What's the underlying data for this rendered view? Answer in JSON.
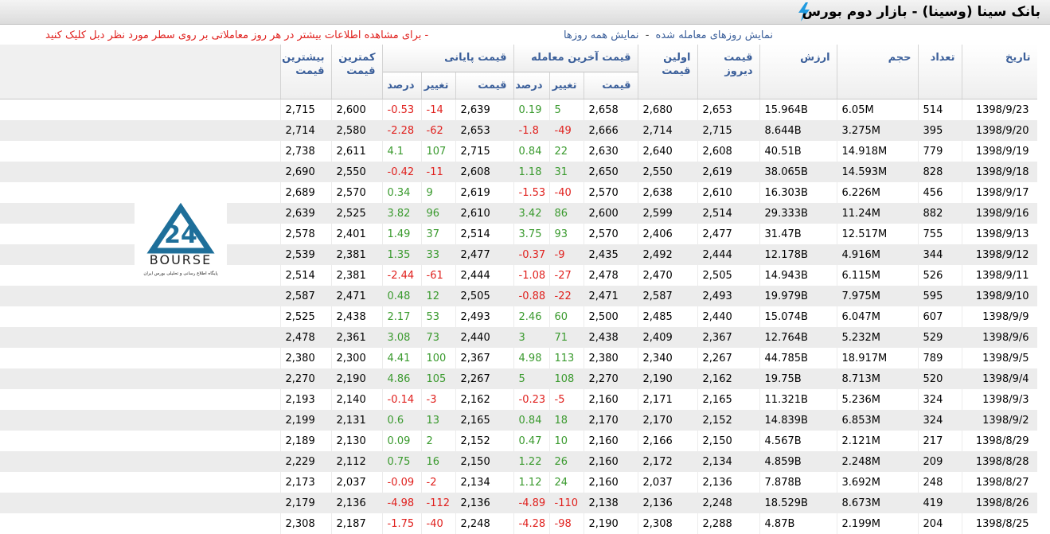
{
  "title": "بانک سینا (وسینا) - بازار دوم بورس",
  "help": {
    "link1": "نمایش روزهای معامله شده",
    "sep": "-",
    "link2": "نمایش همه روزها",
    "instruction": "- برای مشاهده اطلاعات بیشتر در هر روز معاملاتی بر روی سطر مورد نظر دبل کلیک کنید"
  },
  "logo": {
    "name": "BOURSE",
    "mark": "24",
    "tagline": "پایگاه اطلاع رسانی و تحلیلی بورس ایران"
  },
  "headers": {
    "date": "تاریخ",
    "count": "تعداد",
    "volume": "حجم",
    "value": "ارزش",
    "prev_line1": "قیمت",
    "prev_line2": "دیروز",
    "first_line1": "اولین",
    "first_line2": "قیمت",
    "last_group": "قیمت آخرین معامله",
    "close_group": "قیمت پایانی",
    "price": "قیمت",
    "change": "تغییر",
    "percent": "درصد",
    "min_line1": "کمترین",
    "min_line2": "قیمت",
    "max_line1": "بیشترین",
    "max_line2": "قیمت"
  },
  "rows": [
    {
      "date": "1398/9/23",
      "count": "514",
      "volume": "6.05M",
      "value": "15.964B",
      "prev": "2,653",
      "first": "2,680",
      "last_price": "2,658",
      "last_change": "5",
      "last_pct": "0.19",
      "close_price": "2,639",
      "close_change": "-14",
      "close_pct": "-0.53",
      "min": "2,600",
      "max": "2,715"
    },
    {
      "date": "1398/9/20",
      "count": "395",
      "volume": "3.275M",
      "value": "8.644B",
      "prev": "2,715",
      "first": "2,714",
      "last_price": "2,666",
      "last_change": "-49",
      "last_pct": "-1.8",
      "close_price": "2,653",
      "close_change": "-62",
      "close_pct": "-2.28",
      "min": "2,580",
      "max": "2,714"
    },
    {
      "date": "1398/9/19",
      "count": "779",
      "volume": "14.918M",
      "value": "40.51B",
      "prev": "2,608",
      "first": "2,640",
      "last_price": "2,630",
      "last_change": "22",
      "last_pct": "0.84",
      "close_price": "2,715",
      "close_change": "107",
      "close_pct": "4.1",
      "min": "2,611",
      "max": "2,738"
    },
    {
      "date": "1398/9/18",
      "count": "828",
      "volume": "14.593M",
      "value": "38.065B",
      "prev": "2,619",
      "first": "2,550",
      "last_price": "2,650",
      "last_change": "31",
      "last_pct": "1.18",
      "close_price": "2,608",
      "close_change": "-11",
      "close_pct": "-0.42",
      "min": "2,550",
      "max": "2,690"
    },
    {
      "date": "1398/9/17",
      "count": "456",
      "volume": "6.226M",
      "value": "16.303B",
      "prev": "2,610",
      "first": "2,638",
      "last_price": "2,570",
      "last_change": "-40",
      "last_pct": "-1.53",
      "close_price": "2,619",
      "close_change": "9",
      "close_pct": "0.34",
      "min": "2,570",
      "max": "2,689"
    },
    {
      "date": "1398/9/16",
      "count": "882",
      "volume": "11.24M",
      "value": "29.333B",
      "prev": "2,514",
      "first": "2,599",
      "last_price": "2,600",
      "last_change": "86",
      "last_pct": "3.42",
      "close_price": "2,610",
      "close_change": "96",
      "close_pct": "3.82",
      "min": "2,525",
      "max": "2,639"
    },
    {
      "date": "1398/9/13",
      "count": "755",
      "volume": "12.517M",
      "value": "31.47B",
      "prev": "2,477",
      "first": "2,406",
      "last_price": "2,570",
      "last_change": "93",
      "last_pct": "3.75",
      "close_price": "2,514",
      "close_change": "37",
      "close_pct": "1.49",
      "min": "2,401",
      "max": "2,578"
    },
    {
      "date": "1398/9/12",
      "count": "344",
      "volume": "4.916M",
      "value": "12.178B",
      "prev": "2,444",
      "first": "2,492",
      "last_price": "2,435",
      "last_change": "-9",
      "last_pct": "-0.37",
      "close_price": "2,477",
      "close_change": "33",
      "close_pct": "1.35",
      "min": "2,381",
      "max": "2,539"
    },
    {
      "date": "1398/9/11",
      "count": "526",
      "volume": "6.115M",
      "value": "14.943B",
      "prev": "2,505",
      "first": "2,470",
      "last_price": "2,478",
      "last_change": "-27",
      "last_pct": "-1.08",
      "close_price": "2,444",
      "close_change": "-61",
      "close_pct": "-2.44",
      "min": "2,381",
      "max": "2,514"
    },
    {
      "date": "1398/9/10",
      "count": "595",
      "volume": "7.975M",
      "value": "19.979B",
      "prev": "2,493",
      "first": "2,587",
      "last_price": "2,471",
      "last_change": "-22",
      "last_pct": "-0.88",
      "close_price": "2,505",
      "close_change": "12",
      "close_pct": "0.48",
      "min": "2,471",
      "max": "2,587"
    },
    {
      "date": "1398/9/9",
      "count": "607",
      "volume": "6.047M",
      "value": "15.074B",
      "prev": "2,440",
      "first": "2,485",
      "last_price": "2,500",
      "last_change": "60",
      "last_pct": "2.46",
      "close_price": "2,493",
      "close_change": "53",
      "close_pct": "2.17",
      "min": "2,438",
      "max": "2,525"
    },
    {
      "date": "1398/9/6",
      "count": "529",
      "volume": "5.232M",
      "value": "12.764B",
      "prev": "2,367",
      "first": "2,409",
      "last_price": "2,438",
      "last_change": "71",
      "last_pct": "3",
      "close_price": "2,440",
      "close_change": "73",
      "close_pct": "3.08",
      "min": "2,361",
      "max": "2,478"
    },
    {
      "date": "1398/9/5",
      "count": "789",
      "volume": "18.917M",
      "value": "44.785B",
      "prev": "2,267",
      "first": "2,340",
      "last_price": "2,380",
      "last_change": "113",
      "last_pct": "4.98",
      "close_price": "2,367",
      "close_change": "100",
      "close_pct": "4.41",
      "min": "2,300",
      "max": "2,380"
    },
    {
      "date": "1398/9/4",
      "count": "520",
      "volume": "8.713M",
      "value": "19.75B",
      "prev": "2,162",
      "first": "2,190",
      "last_price": "2,270",
      "last_change": "108",
      "last_pct": "5",
      "close_price": "2,267",
      "close_change": "105",
      "close_pct": "4.86",
      "min": "2,190",
      "max": "2,270"
    },
    {
      "date": "1398/9/3",
      "count": "324",
      "volume": "5.236M",
      "value": "11.321B",
      "prev": "2,165",
      "first": "2,171",
      "last_price": "2,160",
      "last_change": "-5",
      "last_pct": "-0.23",
      "close_price": "2,162",
      "close_change": "-3",
      "close_pct": "-0.14",
      "min": "2,140",
      "max": "2,193"
    },
    {
      "date": "1398/9/2",
      "count": "324",
      "volume": "6.853M",
      "value": "14.839B",
      "prev": "2,152",
      "first": "2,170",
      "last_price": "2,170",
      "last_change": "18",
      "last_pct": "0.84",
      "close_price": "2,165",
      "close_change": "13",
      "close_pct": "0.6",
      "min": "2,131",
      "max": "2,199"
    },
    {
      "date": "1398/8/29",
      "count": "217",
      "volume": "2.121M",
      "value": "4.567B",
      "prev": "2,150",
      "first": "2,166",
      "last_price": "2,160",
      "last_change": "10",
      "last_pct": "0.47",
      "close_price": "2,152",
      "close_change": "2",
      "close_pct": "0.09",
      "min": "2,130",
      "max": "2,189"
    },
    {
      "date": "1398/8/28",
      "count": "209",
      "volume": "2.248M",
      "value": "4.859B",
      "prev": "2,134",
      "first": "2,172",
      "last_price": "2,160",
      "last_change": "26",
      "last_pct": "1.22",
      "close_price": "2,150",
      "close_change": "16",
      "close_pct": "0.75",
      "min": "2,112",
      "max": "2,229"
    },
    {
      "date": "1398/8/27",
      "count": "248",
      "volume": "3.692M",
      "value": "7.878B",
      "prev": "2,136",
      "first": "2,037",
      "last_price": "2,160",
      "last_change": "24",
      "last_pct": "1.12",
      "close_price": "2,134",
      "close_change": "-2",
      "close_pct": "-0.09",
      "min": "2,037",
      "max": "2,173"
    },
    {
      "date": "1398/8/26",
      "count": "419",
      "volume": "8.673M",
      "value": "18.529B",
      "prev": "2,248",
      "first": "2,136",
      "last_price": "2,138",
      "last_change": "-110",
      "last_pct": "-4.89",
      "close_price": "2,136",
      "close_change": "-112",
      "close_pct": "-4.98",
      "min": "2,136",
      "max": "2,179"
    },
    {
      "date": "1398/8/25",
      "count": "204",
      "volume": "2.199M",
      "value": "4.87B",
      "prev": "2,288",
      "first": "2,308",
      "last_price": "2,190",
      "last_change": "-98",
      "last_pct": "-4.28",
      "close_price": "2,248",
      "close_change": "-40",
      "close_pct": "-1.75",
      "min": "2,187",
      "max": "2,308"
    }
  ]
}
